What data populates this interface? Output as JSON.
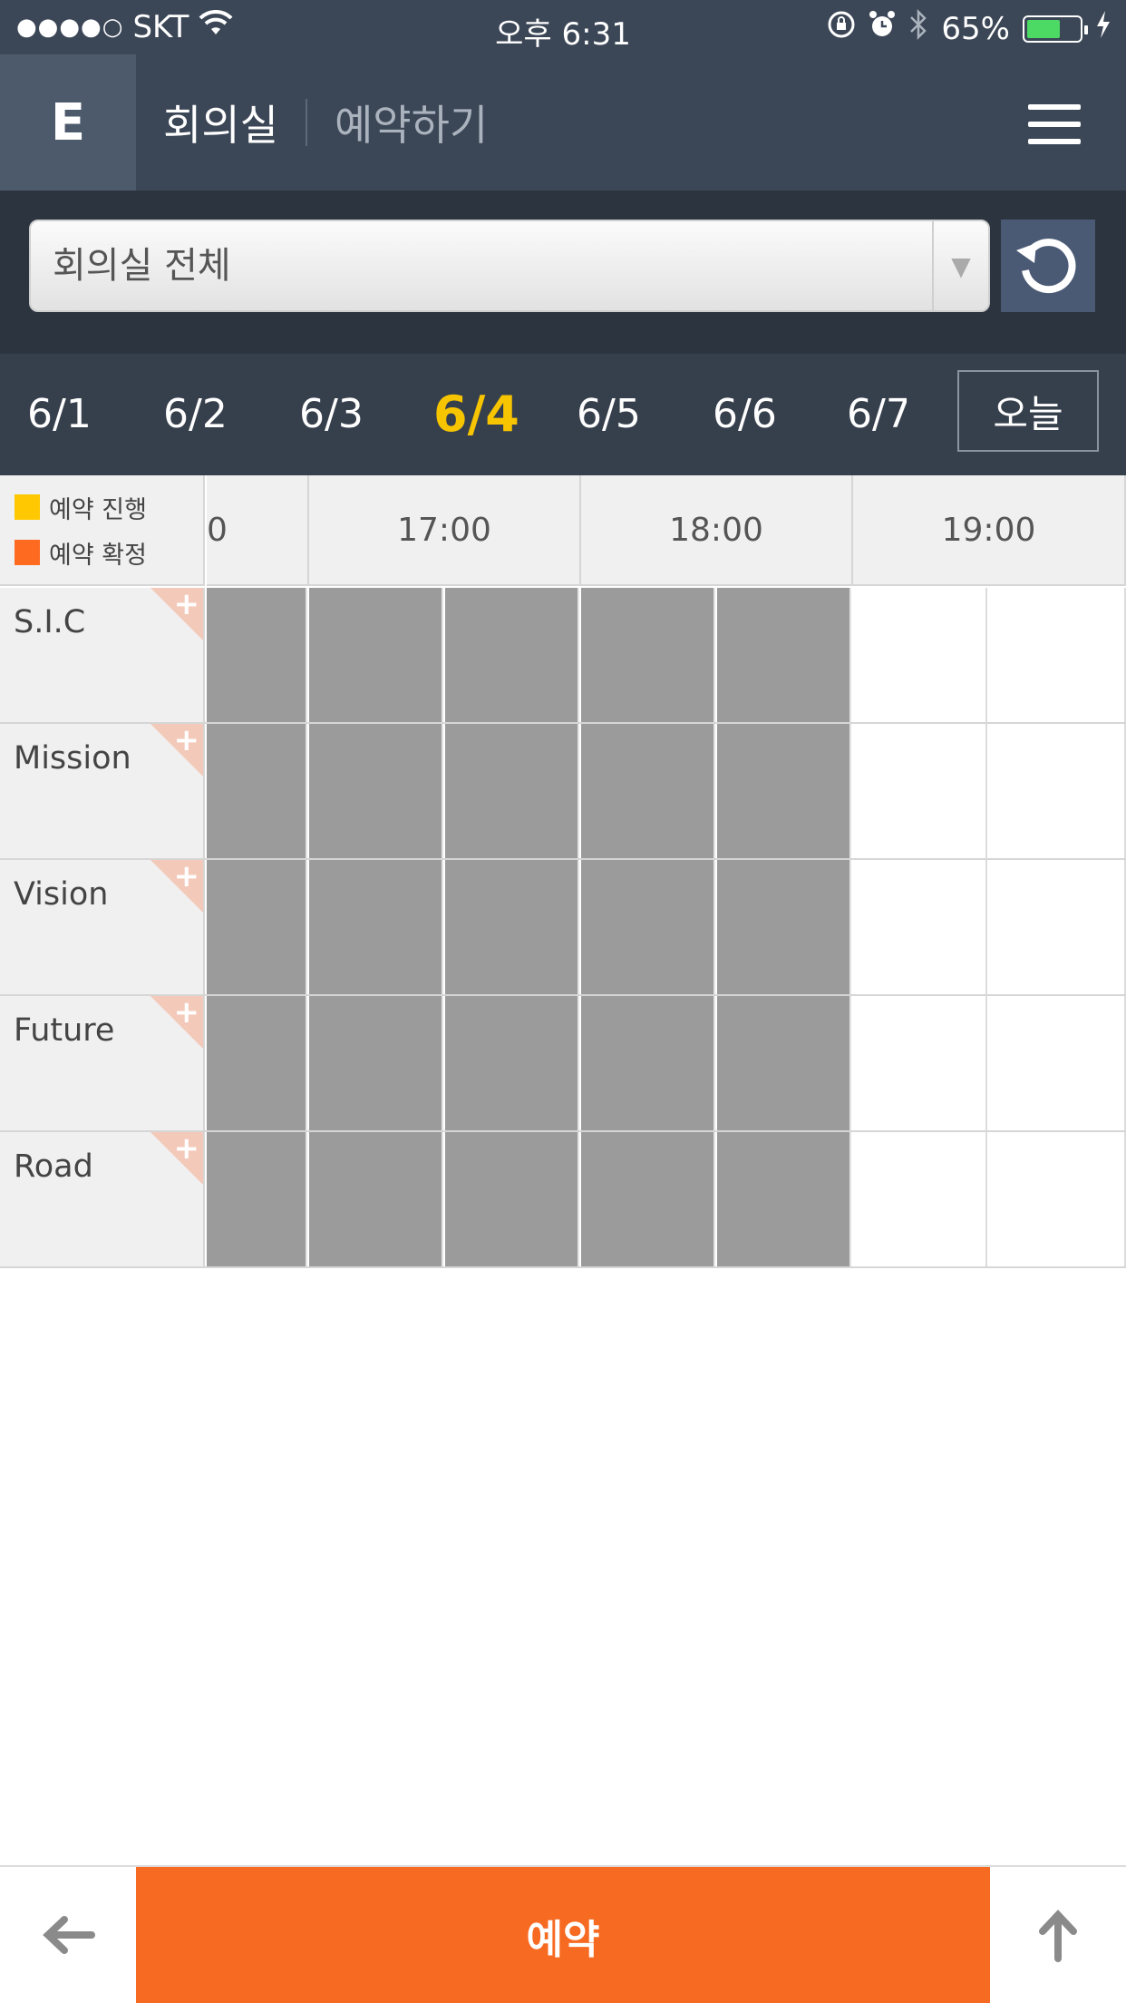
{
  "status_bar": {
    "signal": "●●●●○",
    "carrier": "SKT",
    "time": "오후 6:31",
    "battery": "65%",
    "battery_level": 0.65,
    "icons": [
      "wifi-icon",
      "orientation-lock-icon",
      "alarm-icon",
      "bluetooth-icon",
      "battery-icon",
      "charging-icon"
    ]
  },
  "header": {
    "logo": "E",
    "title": "회의실",
    "subtitle": "예약하기"
  },
  "selector": {
    "value": "회의실 전체"
  },
  "dates": {
    "items": [
      "6/1",
      "6/2",
      "6/3",
      "6/4",
      "6/5",
      "6/6",
      "6/7"
    ],
    "active": "6/4",
    "today_label": "오늘"
  },
  "legend": {
    "pending_label": "예약 진행",
    "pending_color": "#ffc800",
    "confirmed_label": "예약 확정",
    "confirmed_color": "#ff6a21"
  },
  "timeline": {
    "partial_hour_label": "0",
    "hours": [
      "17:00",
      "18:00",
      "19:00"
    ]
  },
  "rooms": [
    {
      "name": "S.I.C"
    },
    {
      "name": "Mission"
    },
    {
      "name": "Vision"
    },
    {
      "name": "Future"
    },
    {
      "name": "Road"
    }
  ],
  "unavailable_until": "18:30",
  "bottom_bar": {
    "reserve_label": "예약"
  }
}
